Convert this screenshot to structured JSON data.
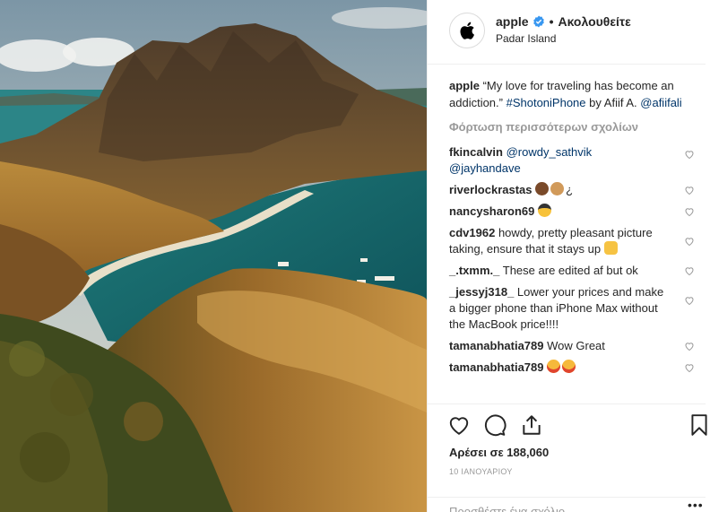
{
  "post": {
    "username": "apple",
    "follow_status": "Ακολουθείτε",
    "location": "Padar Island",
    "caption_text": "“My love for traveling has become an addiction.”",
    "caption_hashtag": "#ShotoniPhone",
    "caption_by": "by Afiif A.",
    "caption_mention": "@afiifali",
    "load_more": "Φόρτωση περισσότερων σχολίων",
    "likes": "Αρέσει σε 188,060",
    "date": "10 ΙΑΝΟΥΑΡΙΟΥ",
    "comment_placeholder": "Προσθέστε ένα σχόλιο...",
    "more_dots": "•••"
  },
  "comments": [
    {
      "user": "fkincalvin",
      "mention1": "@rowdy_sathvik",
      "mention2": "@jayhandave"
    },
    {
      "user": "riverlockrastas",
      "text": "¿",
      "emoji": [
        "woman-emoji",
        "man-emoji"
      ]
    },
    {
      "user": "nancysharon69",
      "emoji": [
        "sunglasses-emoji"
      ]
    },
    {
      "user": "cdv1962",
      "text": "howdy, pretty pleasant picture taking, ensure that it stays up",
      "emoji": [
        "hand-emoji"
      ]
    },
    {
      "user": "_.txmm._",
      "text": "These are edited af but ok"
    },
    {
      "user": "_jessyj318_",
      "text": "Lower your prices and make a bigger phone than iPhone Max without the MacBook price!!!!"
    },
    {
      "user": "tamanabhatia789",
      "text": "Wow Great"
    },
    {
      "user": "tamanabhatia789",
      "emoji": [
        "heart-eyes-emoji",
        "heart-eyes-emoji"
      ]
    }
  ],
  "colors": {
    "text": "#262626",
    "link": "#003569",
    "muted": "#999999",
    "verified": "#3897f0",
    "border": "#efefef"
  }
}
